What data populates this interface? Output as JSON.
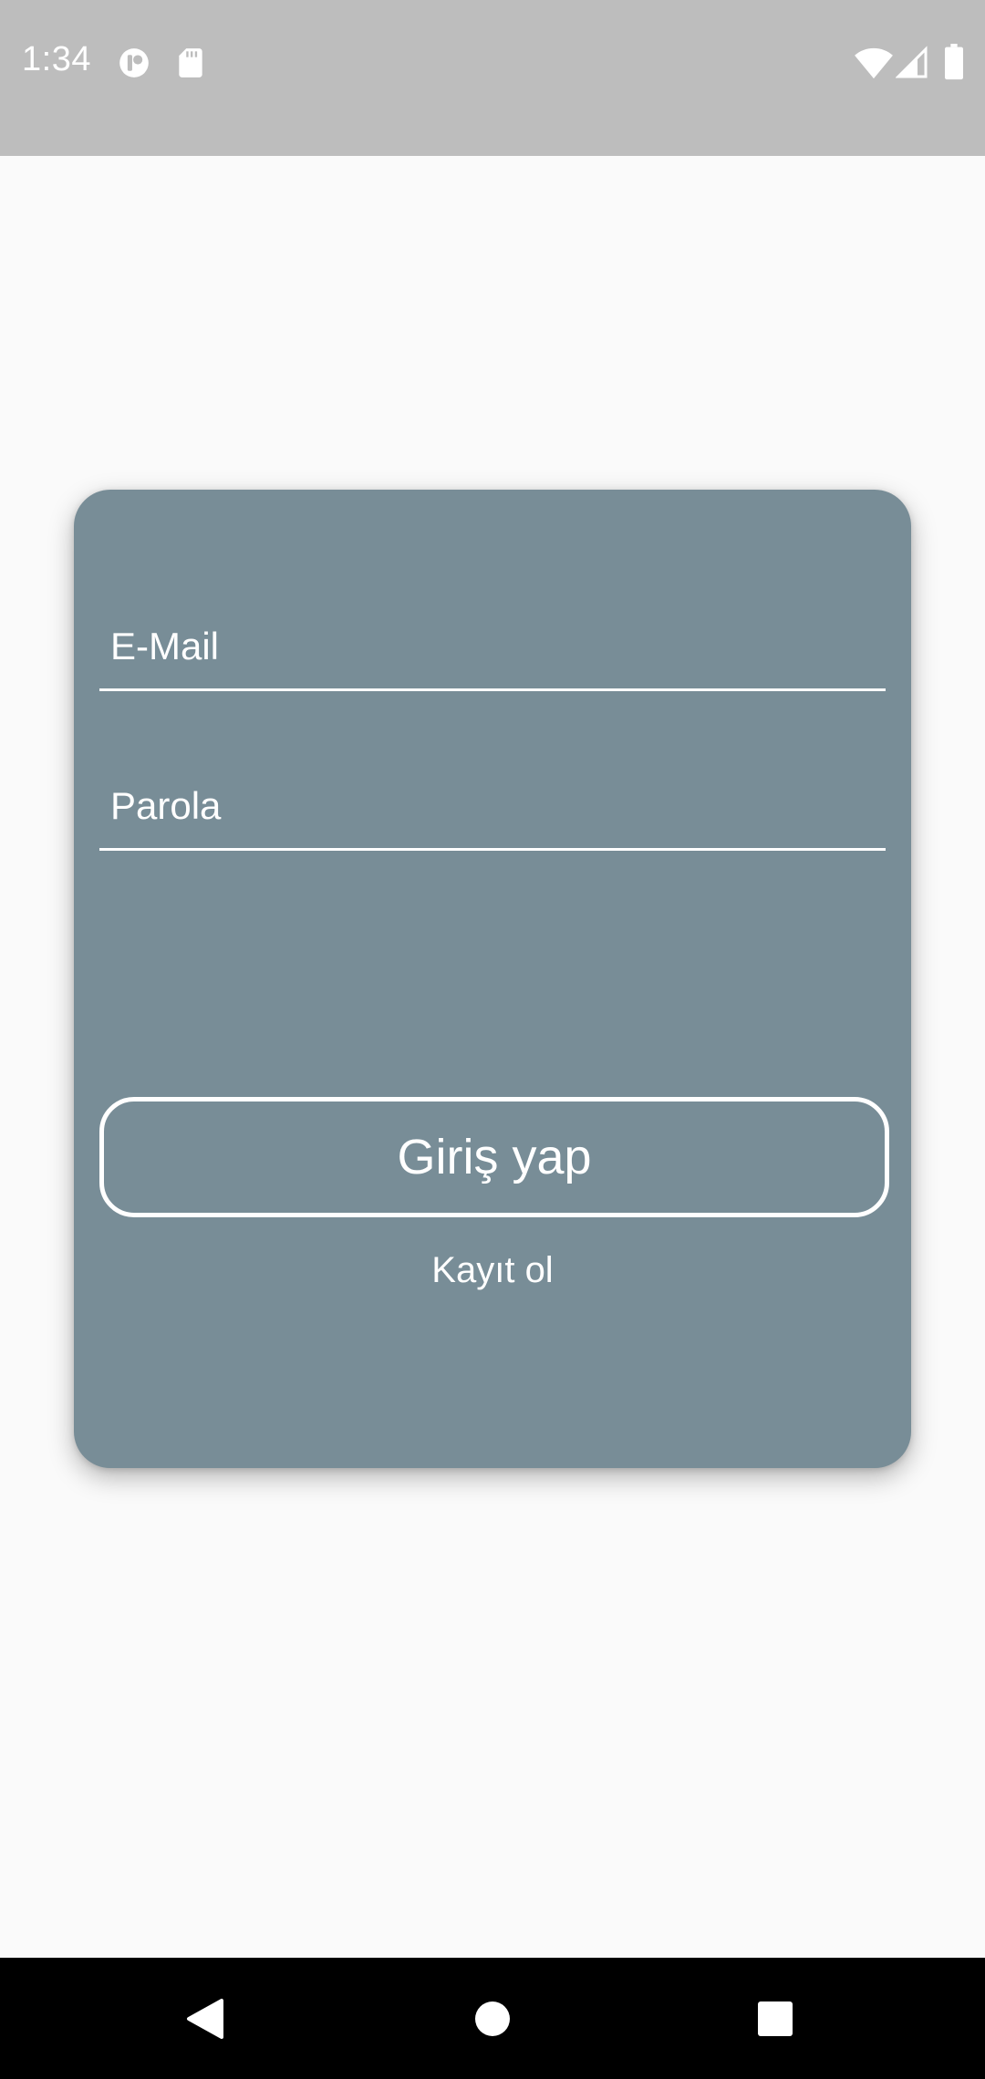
{
  "status_bar": {
    "time": "1:34",
    "background": "#BDBDBD",
    "icons": [
      "notification-app-icon",
      "sd-card-icon",
      "wifi-icon",
      "cellular-signal-icon",
      "battery-icon"
    ]
  },
  "login_card": {
    "background": "#788D97",
    "email_field": {
      "placeholder": "E-Mail",
      "value": ""
    },
    "password_field": {
      "placeholder": "Parola",
      "value": ""
    },
    "login_button_label": "Giriş yap",
    "register_link_label": "Kayıt ol"
  },
  "nav_bar": {
    "icons": [
      "back-icon",
      "home-icon",
      "recents-icon"
    ]
  }
}
